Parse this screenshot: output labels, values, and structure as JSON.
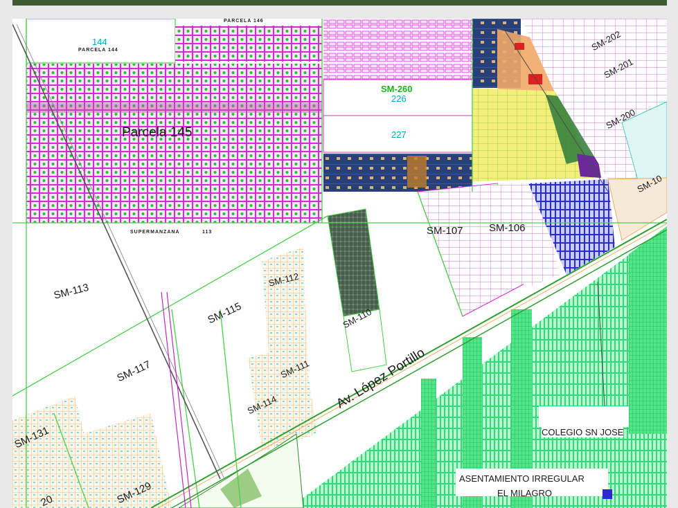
{
  "labels": {
    "parcela_145": "Parcela  145",
    "parcela_144_num": "144",
    "parcela_144": "PARCELA  144",
    "parcela_146": "PARCELA  146",
    "supermanzana": "SUPERMANZANA",
    "supermanzana_num": "113",
    "sm_260": "SM-260",
    "lot_226": "226",
    "lot_227": "227",
    "sm_202": "SM-202",
    "sm_201": "SM-201",
    "sm_200": "SM-200",
    "sm_10x": "SM-10",
    "sm_107": "SM-107",
    "sm_106": "SM-106",
    "sm_113": "SM-113",
    "sm_112": "SM-112",
    "sm_115": "SM-115",
    "sm_110": "SM-110",
    "sm_117": "SM-117",
    "sm_111": "SM-111",
    "sm_114": "SM-114",
    "sm_131": "SM-131",
    "sm_129": "SM-129",
    "sm_130": "20",
    "avenue": "Av. López Portillo",
    "colegio": "COLEGIO SN JOSE",
    "asentamiento_line1": "ASENTAMIENTO IRREGULAR",
    "asentamiento_line2": "EL MILAGRO"
  },
  "colors": {
    "grid_magenta": "#d62ad6",
    "grid_blue": "#3a3ae0",
    "green_lots": "#19d86a",
    "boundary_green": "#48d048",
    "orange_lots": "#e8b060",
    "navy_block": "#27407a",
    "yellow_block": "#f2ef7a",
    "sm260_green": "#1ab31a"
  }
}
